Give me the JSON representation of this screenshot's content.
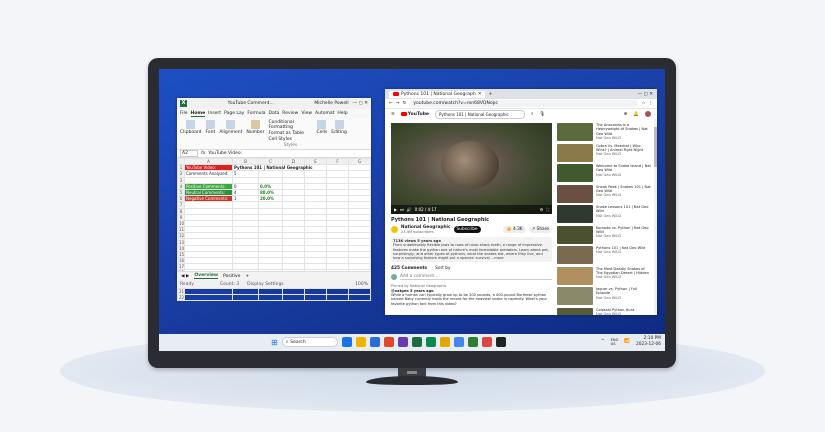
{
  "excel": {
    "title": "YouTube Comment...",
    "user": "Michelle Powell",
    "menu": [
      "File",
      "Home",
      "Insert",
      "Page Lay",
      "Formula",
      "Data",
      "Review",
      "View",
      "Automat",
      "Help"
    ],
    "active_menu": "Home",
    "ribbon": [
      "Clipboard",
      "Font",
      "Alignment",
      "Number",
      "Conditional Formatting",
      "Format as Table",
      "Cell Styles",
      "Cells",
      "Editing"
    ],
    "styles_label": "Styles",
    "name_box": "A2",
    "formula": "YouTube Video:",
    "columns": [
      "A",
      "B",
      "C",
      "D",
      "E",
      "F",
      "G"
    ],
    "rows": [
      {
        "n": "1",
        "a": "YouTube Video:",
        "b": "Pythons 101 | National Geographic",
        "c": "",
        "afill": "#e02020"
      },
      {
        "n": "2",
        "a": "Comments Analyzed:",
        "b": "5",
        "c": "",
        "afill": ""
      },
      {
        "n": "3",
        "a": "",
        "b": "",
        "c": "",
        "afill": ""
      },
      {
        "n": "4",
        "a": "Positive Comments:",
        "b": "0",
        "c": "0.0%",
        "afill": "#3aa83a"
      },
      {
        "n": "5",
        "a": "Neutral Comments:",
        "b": "4",
        "c": "80.0%",
        "afill": "#2f8f3f"
      },
      {
        "n": "6",
        "a": "Negative Comments:",
        "b": "1",
        "c": "20.0%",
        "afill": "#c0392b"
      },
      {
        "n": "7"
      },
      {
        "n": "8"
      },
      {
        "n": "9"
      },
      {
        "n": "10"
      },
      {
        "n": "11"
      },
      {
        "n": "12"
      },
      {
        "n": "13"
      },
      {
        "n": "14"
      },
      {
        "n": "15"
      },
      {
        "n": "16"
      },
      {
        "n": "17"
      },
      {
        "n": "18"
      },
      {
        "n": "19"
      },
      {
        "n": "20"
      },
      {
        "n": "21"
      },
      {
        "n": "22"
      }
    ],
    "tabs": [
      "Overview",
      "Positive"
    ],
    "active_tab": "Overview",
    "status": [
      "Ready",
      "Count: 3",
      "Display Settings",
      "100%"
    ]
  },
  "browser": {
    "tab_title": "Pythons 101 | National Geograph",
    "url": "youtube.com/watch?v=ron68VQNopc",
    "search": "Pythons 101 | National Geographic",
    "player_time": "0:02 / 4:17",
    "video_title": "Pythons 101 | National Geographic",
    "channel": "National Geographic",
    "subscribers": "23.4M subscribers",
    "subscribe": "Subscribe",
    "likes": "4.3K",
    "share": "Share",
    "views": "713K views  5 years ago",
    "description": "From unbelievably flexible jaws to rows of razor-sharp teeth, a range of impressive features make the python one of nature's most formidable predators. Learn about pet, surprisingly, and other types of pythons, what the snakes eat, where they live, and how a surprising feature might put a species' survival ...more",
    "comments_count": "425 Comments",
    "sort": "Sort by",
    "add_comment": "Add a comment...",
    "pinned": "Pinned by National Geographic",
    "commenter": "@natgeo  5 years ago",
    "comment": "While a human can typically grow up to be 200 pounds, a 400-pound Burmese python named Baby currently holds the record for the heaviest snake in captivity. What's your favorite python fact from this video?",
    "related": [
      {
        "title": "The Anaconda Is a Heavyweight of Snakes | Nat Geo Wild",
        "channel": "Nat Geo WILD",
        "color": "#5a6a3a"
      },
      {
        "title": "Cobra Vs. Meerkat | Who Wins? | Animal Fight Night",
        "channel": "Nat Geo WILD",
        "color": "#8a7a4a"
      },
      {
        "title": "Welcome to Snake Island | Nat Geo Wild",
        "channel": "Nat Geo WILD",
        "color": "#3e5a2e"
      },
      {
        "title": "Sneak Peek | Snakes 101 | Nat Geo Wild",
        "channel": "Nat Geo WILD",
        "color": "#6a5040"
      },
      {
        "title": "Snake Lessons 101 | Nat Geo Wild",
        "channel": "Nat Geo WILD",
        "color": "#2e3a30"
      },
      {
        "title": "Komodo vs. Python | Nat Geo Wild",
        "channel": "Nat Geo WILD",
        "color": "#4a5030"
      },
      {
        "title": "Pythons 101 | Nat Geo Wild",
        "channel": "Nat Geo WILD",
        "color": "#7a6a50"
      },
      {
        "title": "The Most Deadly Snakes of The Egyptian Desert | Hidden",
        "channel": "Nat Geo WILD",
        "color": "#b09060"
      },
      {
        "title": "Jaguar vs. Python | Full Episode",
        "channel": "Nat Geo WILD",
        "color": "#8a8a6a"
      },
      {
        "title": "Colossal Python Hunt",
        "channel": "Nat Geo WILD",
        "color": "#5a5a3a"
      }
    ]
  },
  "taskbar": {
    "search": "Search",
    "lang": "ENG\nUS",
    "time": "2:10 PM",
    "date": "2023-12-06",
    "icon_colors": [
      "#1a73e8",
      "#f2b200",
      "#2b6cd6",
      "#e04a2a",
      "#6a3ab0",
      "#1d6f42",
      "#0a8a50",
      "#e0a800",
      "#4285f4",
      "#2e7d32",
      "#d44",
      "#222"
    ]
  }
}
